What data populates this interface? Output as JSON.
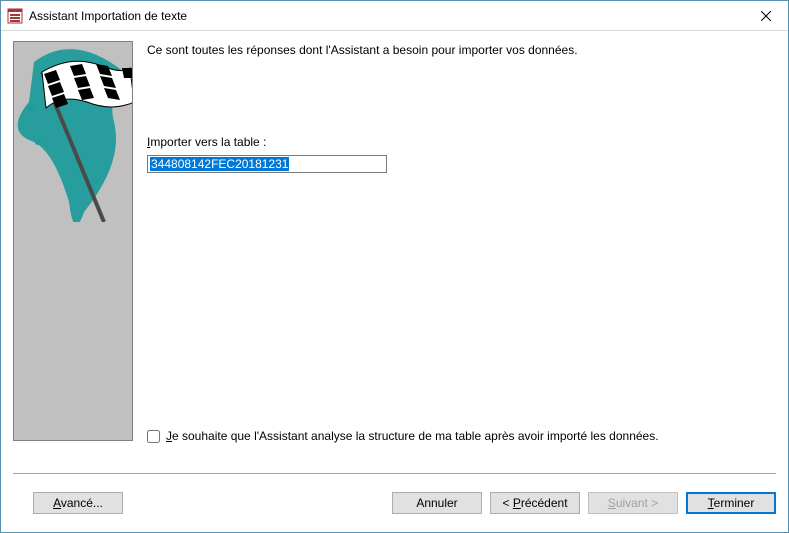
{
  "window": {
    "title": "Assistant Importation de texte"
  },
  "content": {
    "intro": "Ce sont toutes les réponses dont l'Assistant a besoin pour importer vos données.",
    "table_label_prefix": "I",
    "table_label_rest": "mporter vers la table :",
    "table_value": "344808142FEC20181231",
    "analyze_prefix": "J",
    "analyze_rest": "e souhaite que l'Assistant analyse la structure de ma table après avoir importé les données."
  },
  "buttons": {
    "advanced_prefix": "A",
    "advanced_rest": "vancé...",
    "cancel": "Annuler",
    "prev_prefix": "< ",
    "prev_ul": "P",
    "prev_rest": "récédent",
    "next_prefix": "",
    "next_ul": "S",
    "next_rest": "uivant >",
    "finish_ul": "T",
    "finish_rest": "erminer"
  }
}
